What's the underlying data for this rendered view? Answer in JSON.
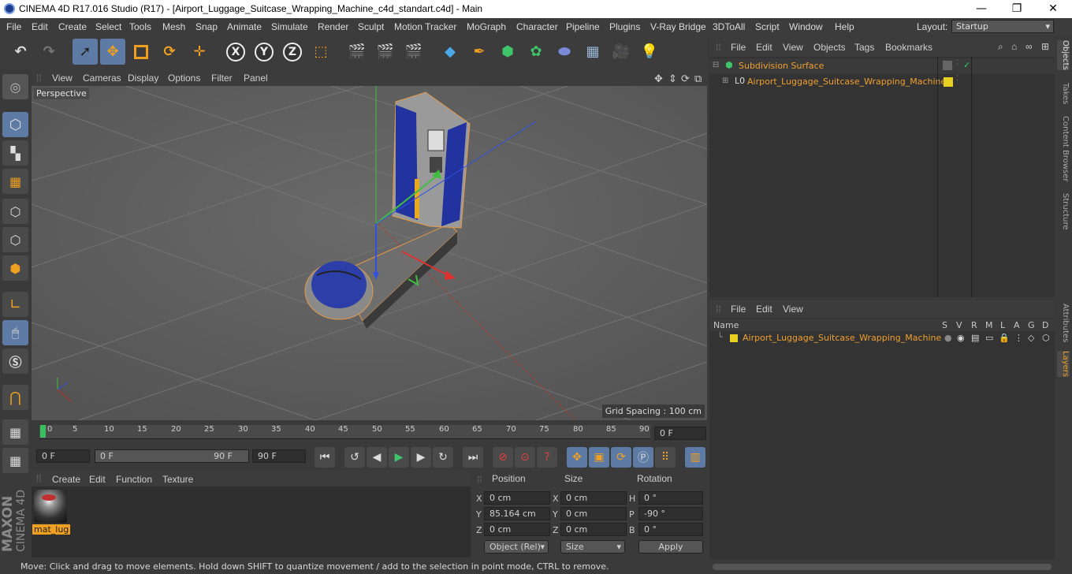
{
  "window": {
    "title": "CINEMA 4D R17.016 Studio (R17) - [Airport_Luggage_Suitcase_Wrapping_Machine_c4d_standart.c4d] - Main",
    "minimize": "—",
    "maximize": "❐",
    "close": "✕"
  },
  "menubar": {
    "items": [
      "File",
      "Edit",
      "Create",
      "Select",
      "Tools",
      "Mesh",
      "Snap",
      "Animate",
      "Simulate",
      "Render",
      "Sculpt",
      "Motion Tracker",
      "MoGraph",
      "Character",
      "Pipeline",
      "Plugins",
      "V-Ray Bridge",
      "3DToAll",
      "Script",
      "Window",
      "Help"
    ],
    "layout_label": "Layout:",
    "layout_value": "Startup"
  },
  "toolbar": {
    "x_label": "X",
    "y_label": "Y",
    "z_label": "Z"
  },
  "viewport": {
    "menu": [
      "View",
      "Cameras",
      "Display",
      "Options",
      "Filter",
      "Panel"
    ],
    "camera_label": "Perspective",
    "grid_spacing": "Grid Spacing : 100 cm"
  },
  "timeline": {
    "ticks": [
      "0",
      "5",
      "10",
      "15",
      "20",
      "25",
      "30",
      "35",
      "40",
      "45",
      "50",
      "55",
      "60",
      "65",
      "70",
      "75",
      "80",
      "85",
      "90"
    ],
    "current_frame": "0 F"
  },
  "transport": {
    "start_field": "0 F",
    "range_start": "0 F",
    "range_end": "90 F",
    "end_field": "90 F"
  },
  "materials": {
    "menu": [
      "Create",
      "Edit",
      "Function",
      "Texture"
    ],
    "items": [
      {
        "name": "mat_lug"
      }
    ]
  },
  "coordinates": {
    "headers": {
      "position": "Position",
      "size": "Size",
      "rotation": "Rotation"
    },
    "rows": [
      {
        "axis": "X",
        "pos": "0 cm",
        "size_axis": "X",
        "size": "0 cm",
        "rot_axis": "H",
        "rot": "0 °"
      },
      {
        "axis": "Y",
        "pos": "85.164 cm",
        "size_axis": "Y",
        "size": "0 cm",
        "rot_axis": "P",
        "rot": "-90 °"
      },
      {
        "axis": "Z",
        "pos": "0 cm",
        "size_axis": "Z",
        "size": "0 cm",
        "rot_axis": "B",
        "rot": "0 °"
      }
    ],
    "mode_select": "Object (Rel)",
    "size_select": "Size",
    "apply": "Apply"
  },
  "status": "Move: Click and drag to move elements. Hold down SHIFT to quantize movement / add to the selection in point mode, CTRL to remove.",
  "objects_panel": {
    "menu": [
      "File",
      "Edit",
      "View",
      "Objects",
      "Tags",
      "Bookmarks"
    ],
    "items": [
      {
        "name": "Subdivision Surface"
      },
      {
        "name": "Airport_Luggage_Suitcase_Wrapping_Machine"
      }
    ]
  },
  "layers_panel": {
    "menu": [
      "File",
      "Edit",
      "View"
    ],
    "name_header": "Name",
    "columns": [
      "S",
      "V",
      "R",
      "M",
      "L",
      "A",
      "G",
      "D"
    ],
    "items": [
      {
        "name": "Airport_Luggage_Suitcase_Wrapping_Machine"
      }
    ]
  },
  "right_tabs": [
    "Objects",
    "Takes",
    "Content Browser",
    "Structure",
    "Attributes",
    "Layers"
  ],
  "brand": {
    "maxon": "MAXON",
    "product": "CINEMA 4D"
  }
}
